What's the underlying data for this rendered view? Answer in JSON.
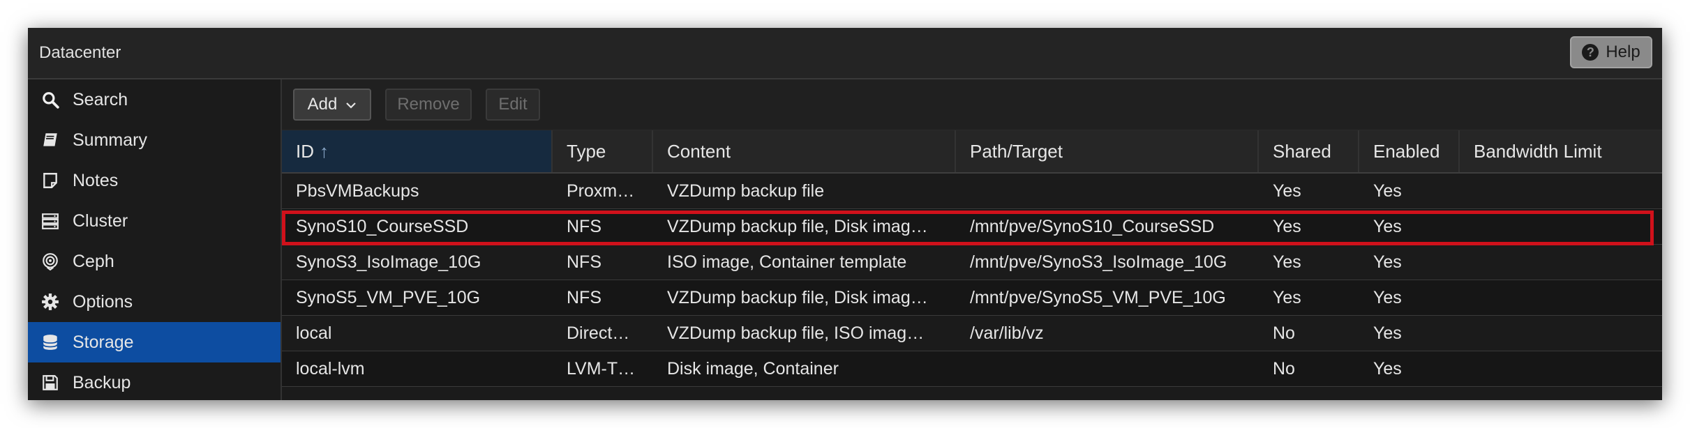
{
  "header": {
    "title": "Datacenter",
    "help_label": "Help"
  },
  "sidebar": {
    "items": [
      {
        "label": "Search",
        "icon": "search-icon"
      },
      {
        "label": "Summary",
        "icon": "book-icon"
      },
      {
        "label": "Notes",
        "icon": "note-icon"
      },
      {
        "label": "Cluster",
        "icon": "server-icon"
      },
      {
        "label": "Ceph",
        "icon": "ceph-icon"
      },
      {
        "label": "Options",
        "icon": "gear-icon"
      },
      {
        "label": "Storage",
        "icon": "database-icon",
        "active": true
      },
      {
        "label": "Backup",
        "icon": "floppy-icon"
      }
    ]
  },
  "toolbar": {
    "add_label": "Add",
    "remove_label": "Remove",
    "edit_label": "Edit"
  },
  "table": {
    "columns": [
      "ID",
      "Type",
      "Content",
      "Path/Target",
      "Shared",
      "Enabled",
      "Bandwidth Limit"
    ],
    "sort_indicator": "↑",
    "rows": [
      [
        "PbsVMBackups",
        "Proxm…",
        "VZDump backup file",
        "",
        "Yes",
        "Yes",
        ""
      ],
      [
        "SynoS10_CourseSSD",
        "NFS",
        "VZDump backup file, Disk imag…",
        "/mnt/pve/SynoS10_CourseSSD",
        "Yes",
        "Yes",
        ""
      ],
      [
        "SynoS3_IsoImage_10G",
        "NFS",
        "ISO image, Container template",
        "/mnt/pve/SynoS3_IsoImage_10G",
        "Yes",
        "Yes",
        ""
      ],
      [
        "SynoS5_VM_PVE_10G",
        "NFS",
        "VZDump backup file, Disk imag…",
        "/mnt/pve/SynoS5_VM_PVE_10G",
        "Yes",
        "Yes",
        ""
      ],
      [
        "local",
        "Direct…",
        "VZDump backup file, ISO imag…",
        "/var/lib/vz",
        "No",
        "Yes",
        ""
      ],
      [
        "local-lvm",
        "LVM-T…",
        "Disk image, Container",
        "",
        "No",
        "Yes",
        ""
      ]
    ]
  },
  "colors": {
    "accent": "#0d4da1",
    "highlight": "#d0111b"
  }
}
